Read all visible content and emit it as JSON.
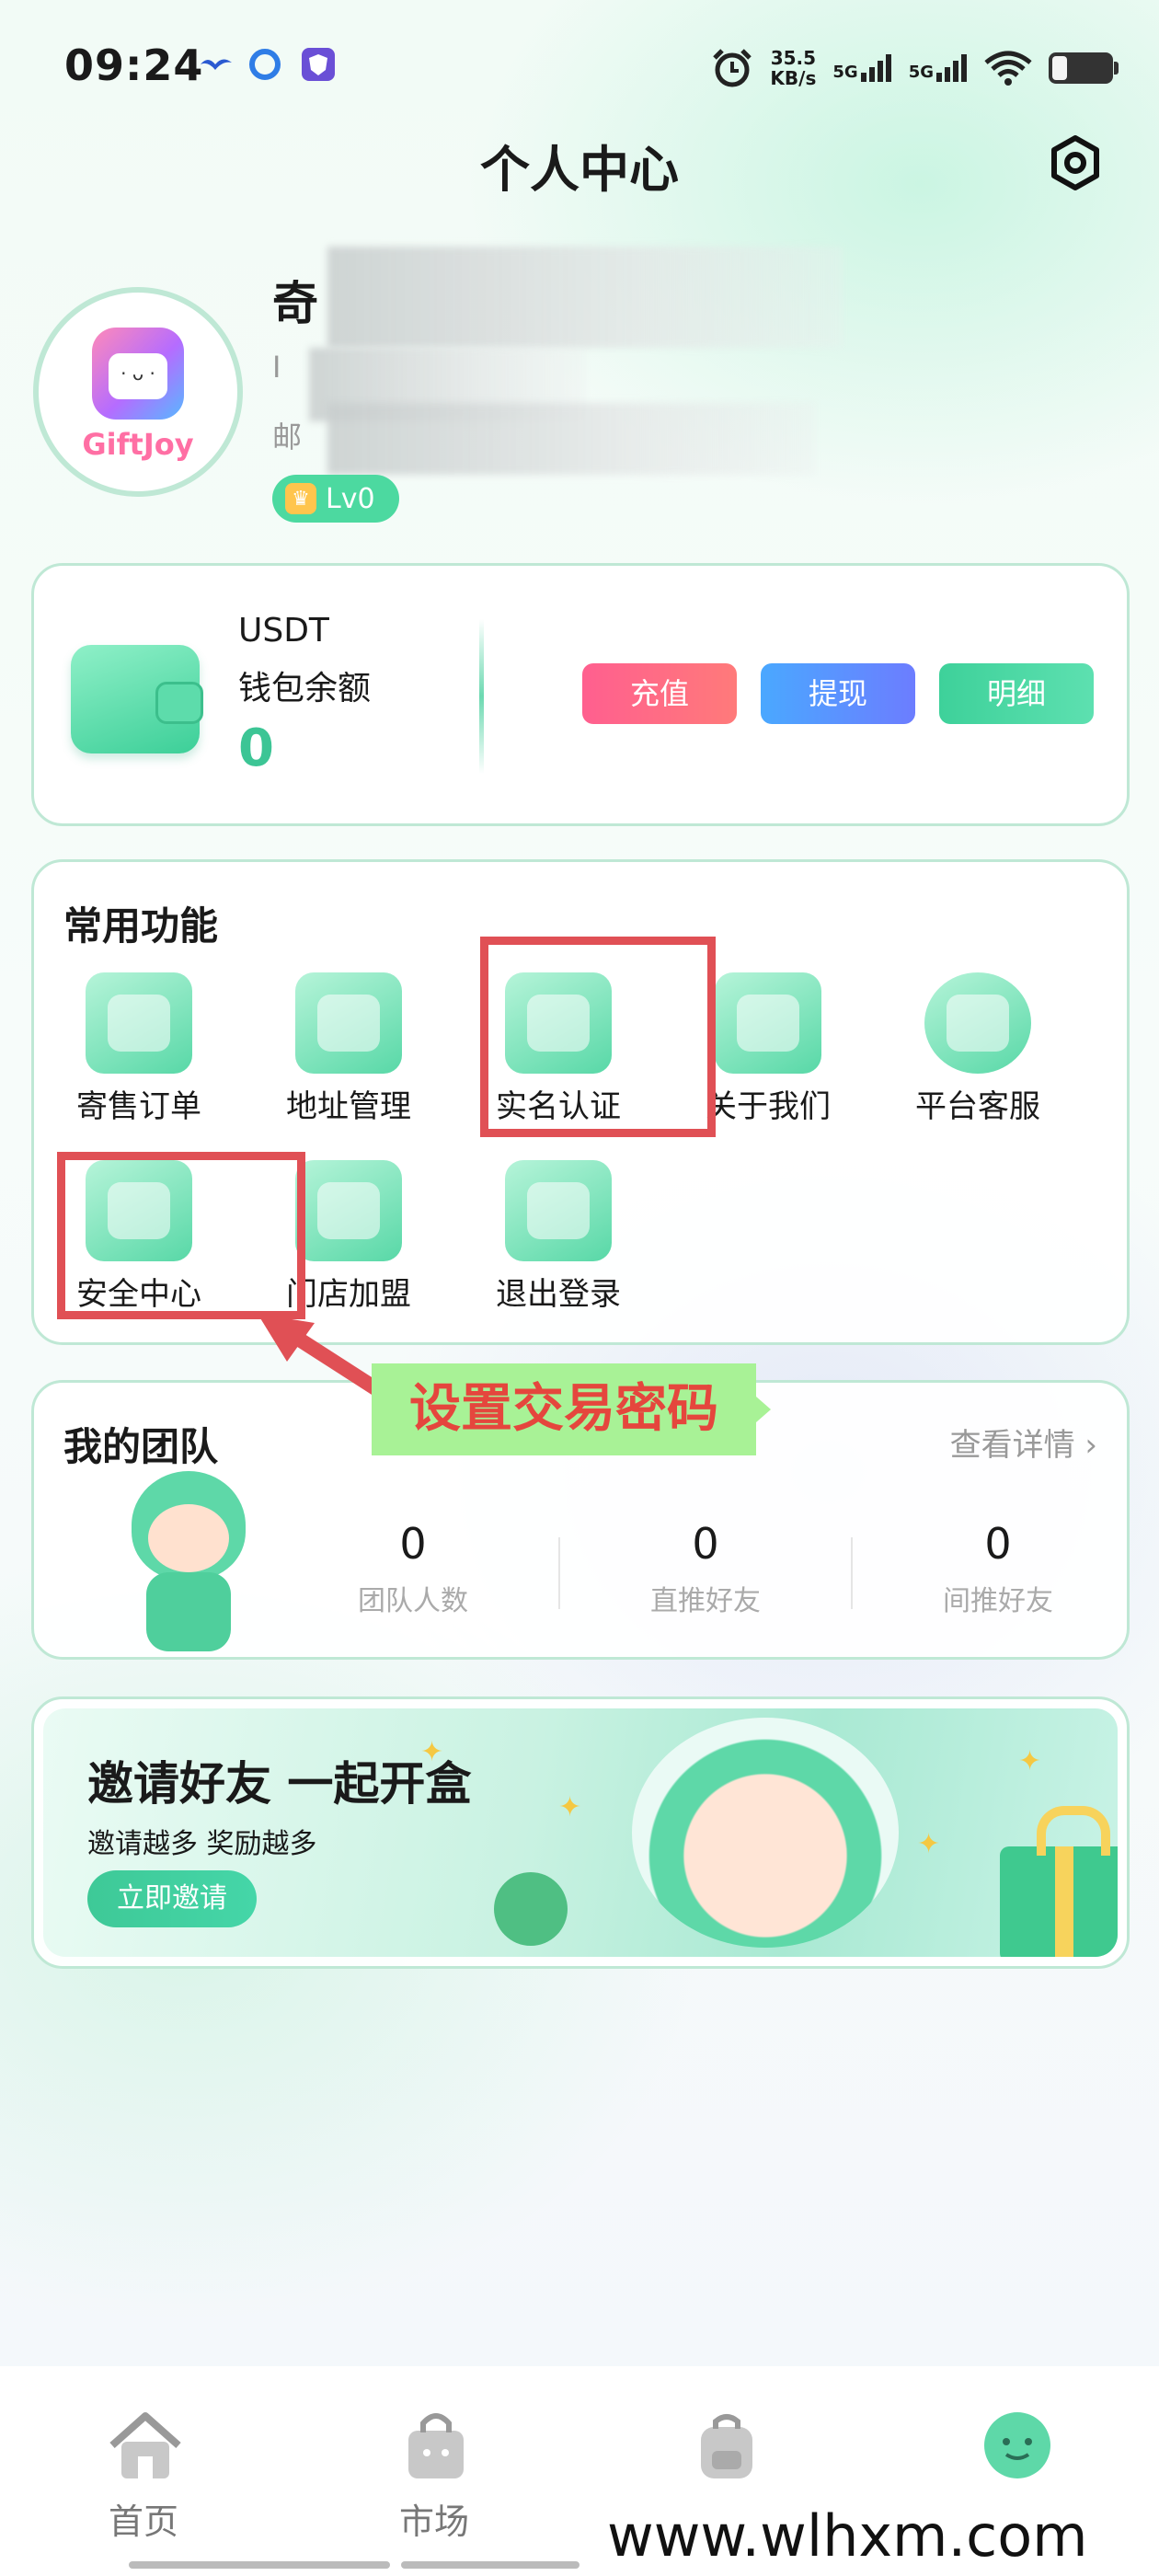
{
  "status_bar": {
    "time": "09:24",
    "net_speed_value": "35.5",
    "net_speed_unit": "KB/s",
    "signal1": "5G",
    "signal2": "5G"
  },
  "header": {
    "title": "个人中心",
    "settings_icon": "settings-hexagon-icon"
  },
  "profile": {
    "avatar_logo": "GiftJoy",
    "name": "奇",
    "id_prefix": "I",
    "email_prefix": "邮",
    "level": "Lv0"
  },
  "wallet": {
    "currency": "USDT",
    "label": "钱包余额",
    "balance": "0",
    "buttons": {
      "recharge": "充值",
      "withdraw": "提现",
      "detail": "明细"
    }
  },
  "functions": {
    "title": "常用功能",
    "items": [
      {
        "label": "寄售订单",
        "icon": "consignment-order-icon"
      },
      {
        "label": "地址管理",
        "icon": "address-pin-icon"
      },
      {
        "label": "实名认证",
        "icon": "real-name-verify-icon"
      },
      {
        "label": "关于我们",
        "icon": "about-us-icon"
      },
      {
        "label": "平台客服",
        "icon": "customer-service-headset-icon"
      },
      {
        "label": "安全中心",
        "icon": "shield-lock-icon"
      },
      {
        "label": "门店加盟",
        "icon": "store-icon"
      },
      {
        "label": "退出登录",
        "icon": "logout-icon"
      }
    ]
  },
  "annotation": {
    "text": "设置交易密码"
  },
  "team": {
    "title": "我的团队",
    "more": "查看详情",
    "stats": [
      {
        "value": "0",
        "label": "团队人数"
      },
      {
        "value": "0",
        "label": "直推好友"
      },
      {
        "value": "0",
        "label": "间推好友"
      }
    ]
  },
  "invite": {
    "title": "邀请好友 一起开盒",
    "subtitle": "邀请越多 奖励越多",
    "button": "立即邀请"
  },
  "tab_bar": {
    "tabs": [
      {
        "label": "首页",
        "icon": "home-icon"
      },
      {
        "label": "市场",
        "icon": "market-bag-icon"
      },
      {
        "label": "",
        "icon": "backpack-icon"
      },
      {
        "label": "",
        "icon": "smiley-profile-icon"
      }
    ]
  },
  "watermark": "www.wlhxm.com",
  "colors": {
    "accent": "#3cc595",
    "card_border": "#bfe8d5",
    "highlight": "#e05055",
    "recharge": "#ff5f8f",
    "withdraw": "#4aa8ff",
    "detail": "#3ed19a"
  }
}
